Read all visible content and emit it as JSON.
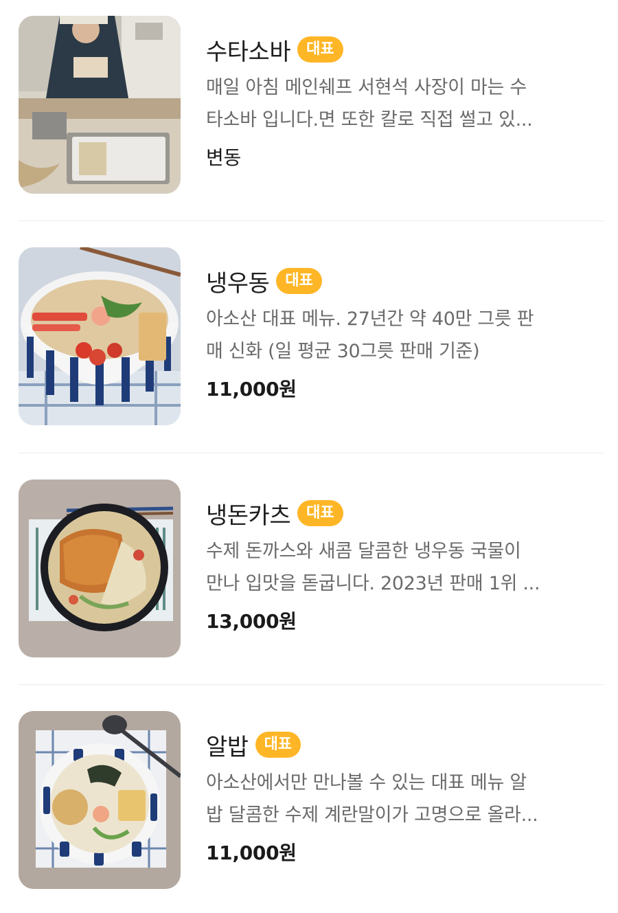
{
  "menu": {
    "badge_label": "대표",
    "items": [
      {
        "name": "수타소바",
        "description_lines": [
          "매일 아침 메인쉐프 서현석 사장이 마는 수",
          "타소바 입니다.면 또한 칼로 직접 썰고 있..."
        ],
        "price": "변동",
        "image_icon": "chef-making-noodles-photo"
      },
      {
        "name": "냉우동",
        "description_lines": [
          "아소산 대표 메뉴. 27년간 약 40만 그릇 판",
          "매 신화 (일 평균 30그릇 판매 기준)"
        ],
        "price": "11,000원",
        "image_icon": "cold-udon-bowl-photo"
      },
      {
        "name": "냉돈카츠",
        "description_lines": [
          "수제 돈까스와 새콤 달콤한 냉우동 국물이",
          "만나 입맛을 돋굽니다. 2023년 판매 1위 ..."
        ],
        "price": "13,000원",
        "image_icon": "cold-donkatsu-bowl-photo"
      },
      {
        "name": "알밥",
        "description_lines": [
          "아소산에서만 만나볼 수 있는 대표 메뉴 알",
          "밥 달콤한 수제 계란말이가 고명으로 올라..."
        ],
        "price": "11,000원",
        "image_icon": "albap-bowl-photo"
      }
    ]
  },
  "colors": {
    "badge": "#ffb626",
    "divider": "#ececec",
    "description": "#6a6a6a"
  }
}
